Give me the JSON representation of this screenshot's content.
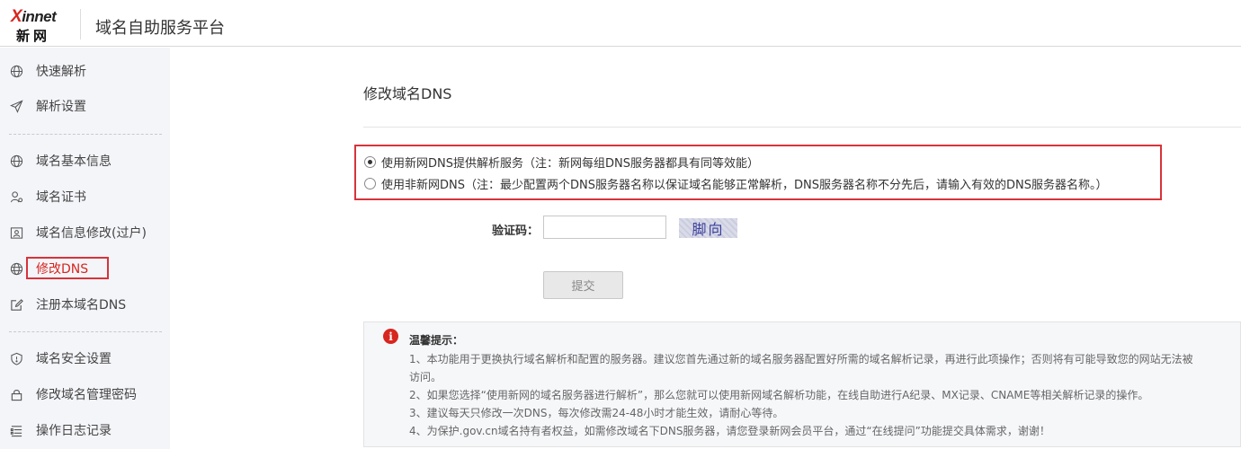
{
  "header": {
    "logo_top_x": "X",
    "logo_top_rest": "innet",
    "logo_bottom": "新网",
    "platform_title": "域名自助服务平台"
  },
  "sidebar": {
    "items": [
      {
        "label": "快速解析",
        "icon": "globe-icon"
      },
      {
        "label": "解析设置",
        "icon": "send-icon"
      },
      {
        "label": "域名基本信息",
        "icon": "globe-icon"
      },
      {
        "label": "域名证书",
        "icon": "user-cert-icon"
      },
      {
        "label": "域名信息修改(过户)",
        "icon": "id-card-icon"
      },
      {
        "label": "修改DNS",
        "icon": "dns-globe-icon",
        "active": true
      },
      {
        "label": "注册本域名DNS",
        "icon": "edit-icon"
      },
      {
        "label": "域名安全设置",
        "icon": "shield-icon"
      },
      {
        "label": "修改域名管理密码",
        "icon": "lock-icon"
      },
      {
        "label": "操作日志记录",
        "icon": "list-icon"
      }
    ]
  },
  "main": {
    "title": "修改域名DNS",
    "options": [
      {
        "label": "使用新网DNS提供解析服务（注：新网每组DNS服务器都具有同等效能）",
        "checked": true
      },
      {
        "label": "使用非新网DNS（注：最少配置两个DNS服务器名称以保证域名能够正常解析，DNS服务器名称不分先后，请输入有效的DNS服务器名称。）",
        "checked": false
      }
    ],
    "captcha_label": "验证码：",
    "captcha_value": "",
    "captcha_text": "脚向",
    "submit_label": "提交"
  },
  "tips": {
    "icon": "info-icon",
    "title": "温馨提示：",
    "lines": [
      "1、本功能用于更换执行域名解析和配置的服务器。建议您首先通过新的域名服务器配置好所需的域名解析记录，再进行此项操作；否则将有可能导致您的网站无法被",
      "访问。",
      "2、如果您选择“使用新网的域名服务器进行解析”，那么您就可以使用新网域名解析功能，在线自助进行A纪录、MX记录、CNAME等相关解析记录的操作。",
      "3、建议每天只修改一次DNS，每次修改需24-48小时才能生效，请耐心等待。",
      "4、为保护.gov.cn域名持有者权益，如需修改域名下DNS服务器，请您登录新网会员平台，通过“在线提问”功能提交具体需求，谢谢！"
    ]
  },
  "colors": {
    "accent_red": "#d7261f",
    "sidebar_bg": "#f4f5f9"
  }
}
